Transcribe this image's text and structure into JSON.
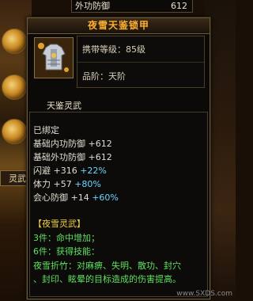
{
  "top_row": {
    "label": "外功防御",
    "value": "612"
  },
  "side": {
    "label": "灵武"
  },
  "tooltip": {
    "title": "夜雪天鉴锁甲",
    "level_req": "携带等级：85级",
    "grade": "品阶：天阶",
    "section": "天鉴灵武",
    "bound": "已绑定",
    "stats": [
      {
        "name": "基础内功防御",
        "base": "+612",
        "extra": ""
      },
      {
        "name": "基础外功防御",
        "base": "+612",
        "extra": ""
      },
      {
        "name": "闪避",
        "base": "+316",
        "extra": "+22%"
      },
      {
        "name": "体力",
        "base": "+57",
        "extra": "+80%"
      },
      {
        "name": "会心防御",
        "base": "+14",
        "extra": "+60%"
      }
    ],
    "set_name": "【夜雪灵武】",
    "set_3": "3件：命中增加；",
    "set_6": "6件：获得技能：",
    "skill_line1": "夜雪折竹：对麻痹、失明、散功、封穴",
    "skill_line2": "、封印、眩晕的目标造成的伤害提高。"
  },
  "watermark": "www.SXDS.com"
}
